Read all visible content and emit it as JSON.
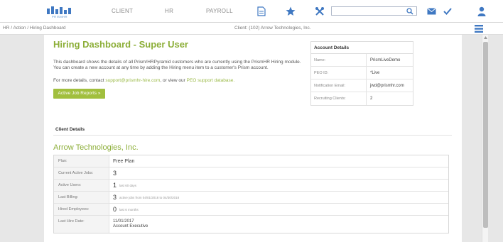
{
  "header": {
    "logo_text": "PRISMHR",
    "nav": {
      "client": "CLIENT",
      "hr": "HR",
      "payroll": "PAYROLL"
    },
    "search_value": ""
  },
  "breadcrumb": "HR / Action / Hiring Dashboard",
  "client_selector": "Client: (102) Arrow Technologies, Inc.",
  "dashboard": {
    "title": "Hiring Dashboard - Super User",
    "intro": "This dashboard shows the details of all Prism/HRPyramid customers who are currently using the PrismHR Hiring module. You can create a new account at any time by adding the Hiring menu item to a customer's Prism account.",
    "contact_prefix": "For more details, contact",
    "contact_email": "support@prismhr-hire.com",
    "contact_middle": ", or view our",
    "contact_db": "PEO support database.",
    "reports_button": "Active Job Reports »"
  },
  "account_details": {
    "heading": "Account Details",
    "rows": [
      {
        "label": "Name:",
        "value": "PrismLiveDemo"
      },
      {
        "label": "PEO ID:",
        "value": "*Live"
      },
      {
        "label": "Notification Email:",
        "value": "jwd@prismhr.com"
      },
      {
        "label": "Recruiting Clients:",
        "value": "2"
      }
    ]
  },
  "client_details": {
    "heading": "Client Details",
    "company": "Arrow Technologies, Inc.",
    "rows": [
      {
        "label": "Plan:",
        "value": "Free Plan",
        "note": ""
      },
      {
        "label": "Current Active Jobs:",
        "value": "3",
        "note": ""
      },
      {
        "label": "Active Users:",
        "value": "1",
        "note": "last 60 days"
      },
      {
        "label": "Last Billing:",
        "value": "3",
        "note": "active jobs from 04/01/2018 to 04/30/2018"
      },
      {
        "label": "Hired Employees:",
        "value": "0",
        "note": "last 6 months"
      },
      {
        "label": "Last Hire Date:",
        "value": "11/01/2017",
        "note": "Account Executive"
      }
    ]
  },
  "colors": {
    "brand_green": "#8cae38",
    "button_green": "#a1bf3e",
    "icon_blue": "#3f78c2"
  }
}
